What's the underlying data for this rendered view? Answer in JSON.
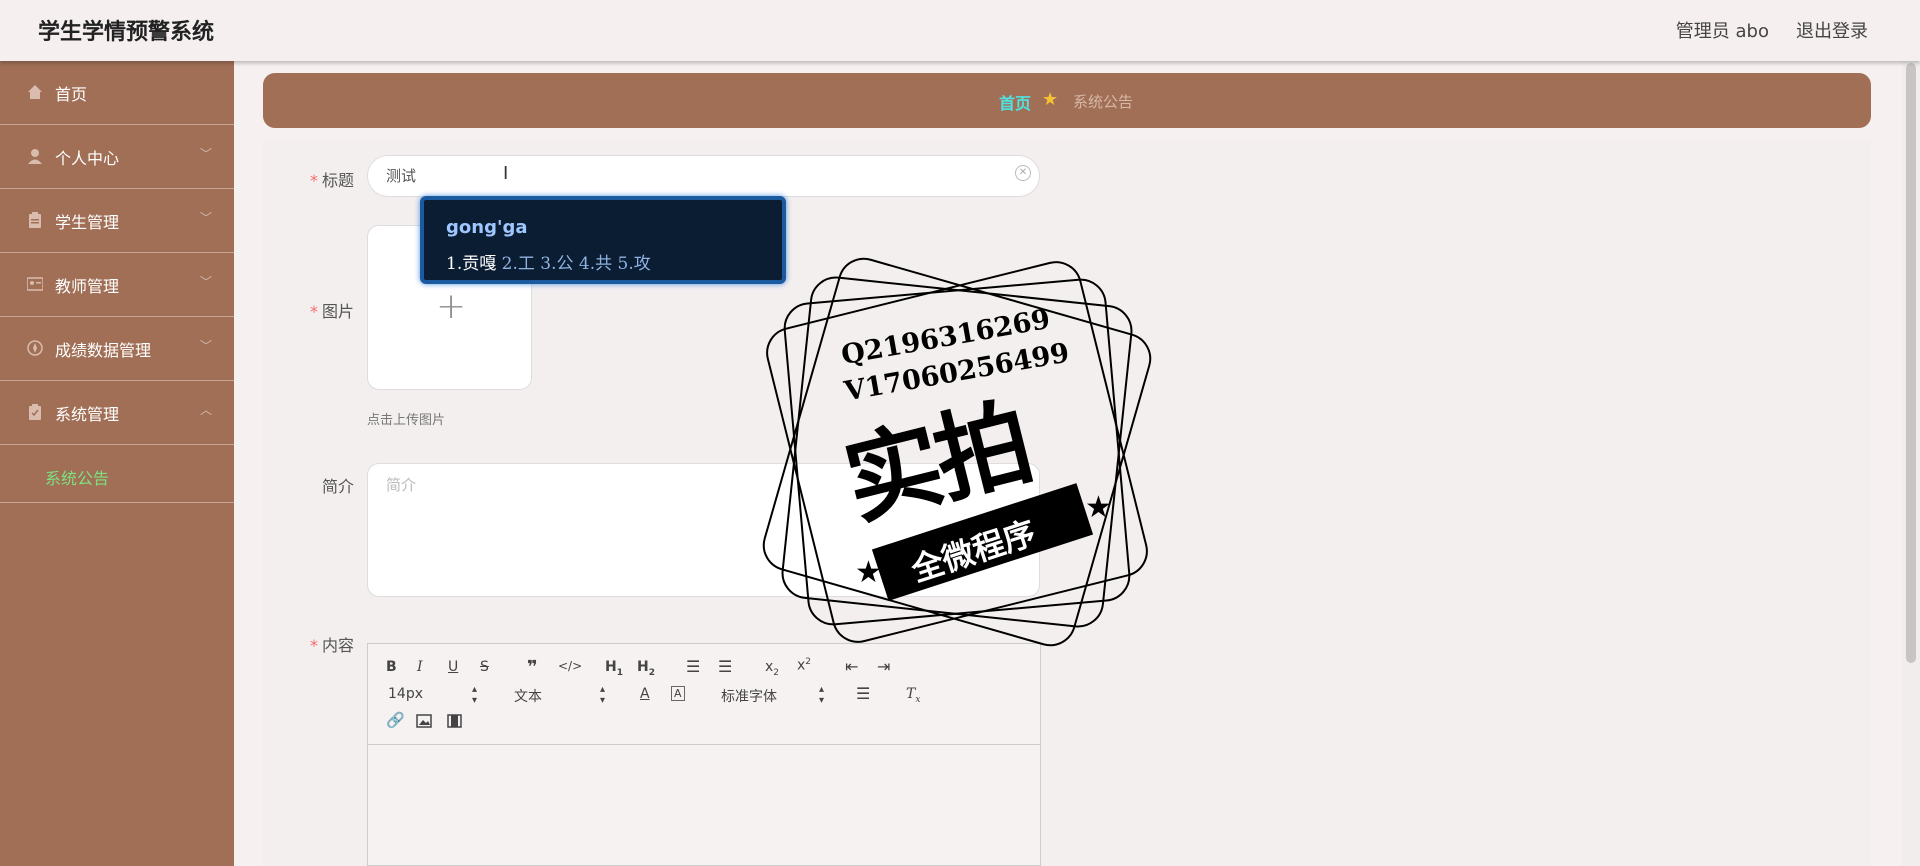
{
  "app": {
    "title": "学生学情预警系统"
  },
  "header": {
    "user": "管理员 abo",
    "logout": "退出登录"
  },
  "sidebar": {
    "items": [
      {
        "label": "首页",
        "icon": "home-icon"
      },
      {
        "label": "个人中心",
        "icon": "user-icon",
        "expandable": true
      },
      {
        "label": "学生管理",
        "icon": "clipboard-icon",
        "expandable": true
      },
      {
        "label": "教师管理",
        "icon": "id-card-icon",
        "expandable": true
      },
      {
        "label": "成绩数据管理",
        "icon": "compass-icon",
        "expandable": true
      },
      {
        "label": "系统管理",
        "icon": "clipboard-check-icon",
        "expanded": true
      }
    ],
    "sub_items": [
      {
        "label": "系统公告",
        "active": true
      }
    ]
  },
  "breadcrumb": {
    "home": "首页",
    "current": "系统公告"
  },
  "form": {
    "title_label": "标题",
    "title_value": "测试",
    "image_label": "图片",
    "upload_hint": "点击上传图片",
    "intro_label": "简介",
    "intro_placeholder": "简介",
    "content_label": "内容"
  },
  "editor": {
    "font_size": "14px",
    "block_type": "文本",
    "font_family": "标准字体"
  },
  "ime": {
    "composition": "gong'ga",
    "candidates": "1.贡嘎 2.工 3.公 4.共 5.攻",
    "first": "1.贡嘎",
    "rest": " 2.工 3.公 4.共 5.攻"
  },
  "watermark": {
    "line1": "Q2196316269",
    "line2": "V17060256499",
    "big": "实拍",
    "ribbon": "全微程序"
  },
  "colors": {
    "sidebar": "#a06f56",
    "accent_green": "#7fe07f",
    "breadcrumb_home": "#4fe3e3",
    "required": "#f56c6c"
  }
}
